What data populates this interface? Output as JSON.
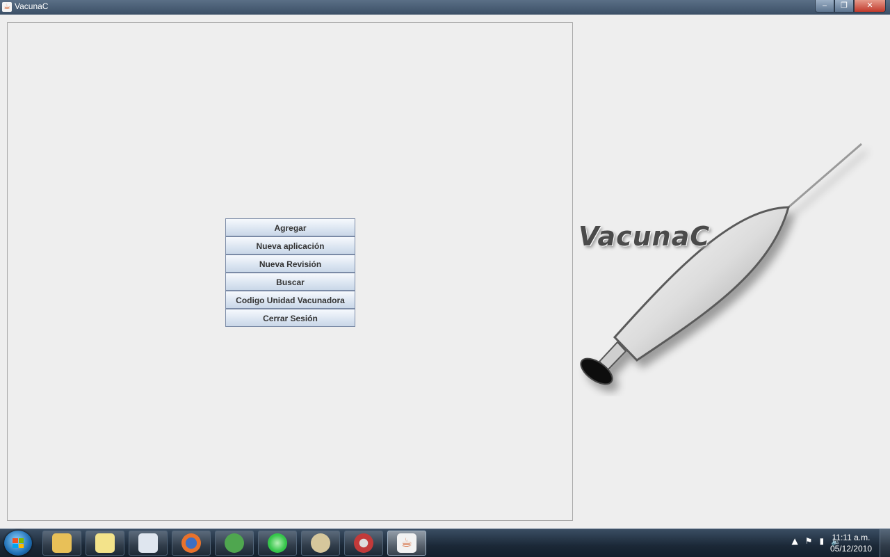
{
  "window": {
    "title": "VacunaC",
    "minimize": "‒",
    "maximize": "❐",
    "close": "✕"
  },
  "menu": {
    "buttons": [
      {
        "label": "Agregar"
      },
      {
        "label": "Nueva aplicación"
      },
      {
        "label": "Nueva Revisión"
      },
      {
        "label": "Buscar"
      },
      {
        "label": "Codigo Unidad Vacunadora"
      },
      {
        "label": "Cerrar Sesión"
      }
    ]
  },
  "logo": {
    "text": "VacunaC"
  },
  "taskbar": {
    "items": [
      {
        "name": "windows-explorer-icon",
        "color": "#e8c058"
      },
      {
        "name": "sticky-notes-icon",
        "color": "#f3e38a"
      },
      {
        "name": "odf-document-icon",
        "color": "#dfe6ef"
      },
      {
        "name": "firefox-icon",
        "color": "#e8722c"
      },
      {
        "name": "messenger-icon",
        "color": "#4fa64f"
      },
      {
        "name": "green-app-icon",
        "color": "#35c64a"
      },
      {
        "name": "paint-icon",
        "color": "#d6c79c"
      },
      {
        "name": "security-icon",
        "color": "#c23a3a"
      },
      {
        "name": "java-icon",
        "color": "#f2f2f2"
      }
    ],
    "clock": {
      "time": "11:11 a.m.",
      "date": "05/12/2010"
    }
  }
}
